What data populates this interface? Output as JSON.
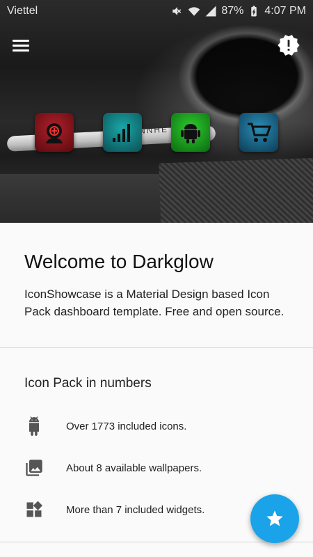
{
  "status_bar": {
    "carrier": "Viettel",
    "battery": "87%",
    "time": "4:07 PM"
  },
  "header": {
    "cable_text": "ENNHE",
    "showcase_icons": [
      "camera-app-icon",
      "signal-bars-icon",
      "android-robot-icon",
      "shopping-cart-icon"
    ]
  },
  "welcome": {
    "title": "Welcome to Darkglow",
    "description": "IconShowcase is a Material Design based Icon Pack dashboard template. Free and open source."
  },
  "numbers": {
    "title": "Icon Pack in numbers",
    "items": [
      {
        "icon": "android-icon",
        "text": "Over 1773 included icons."
      },
      {
        "icon": "image-gallery-icon",
        "text": "About 8 available wallpapers."
      },
      {
        "icon": "widgets-icon",
        "text": "More than 7 included widgets."
      }
    ]
  },
  "colors": {
    "fab": "#1aa3e8",
    "background": "#fafafa"
  }
}
